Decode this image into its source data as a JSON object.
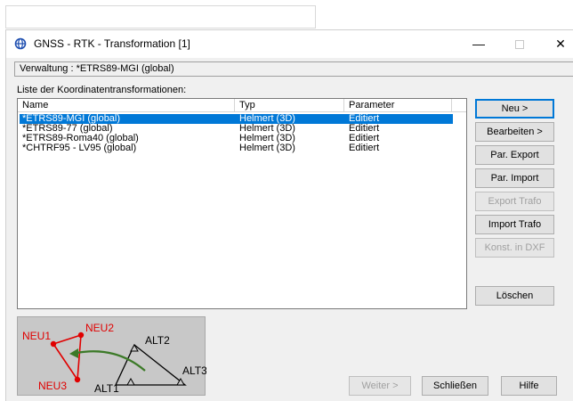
{
  "window": {
    "title": "GNSS - RTK - Transformation [1]",
    "minimize": "—",
    "close": "✕"
  },
  "verwaltung": "Verwaltung : *ETRS89-MGI (global)",
  "list": {
    "label": "Liste der Koordinatentransformationen:",
    "columns": [
      "Name",
      "Typ",
      "Parameter"
    ],
    "rows": [
      {
        "name": "*ETRS89-MGI (global)",
        "typ": "Helmert (3D)",
        "parameter": "Editiert",
        "selected": true
      },
      {
        "name": "*ETRS89-77 (global)",
        "typ": "Helmert (3D)",
        "parameter": "Editiert",
        "selected": false
      },
      {
        "name": "*ETRS89-Roma40 (global)",
        "typ": "Helmert (3D)",
        "parameter": "Editiert",
        "selected": false
      },
      {
        "name": "*CHTRF95 - LV95 (global)",
        "typ": "Helmert (3D)",
        "parameter": "Editiert",
        "selected": false
      }
    ]
  },
  "buttons": {
    "neu": "Neu >",
    "bearbeiten": "Bearbeiten >",
    "par_export": "Par. Export",
    "par_import": "Par. Import",
    "export_trafo": "Export Trafo",
    "import_trafo": "Import Trafo",
    "konst_dxf": "Konst. in DXF",
    "loeschen": "Löschen",
    "weiter": "Weiter >",
    "schliessen": "Schließen",
    "hilfe": "Hilfe"
  },
  "diagram": {
    "neu1": "NEU1",
    "neu2": "NEU2",
    "neu3": "NEU3",
    "alt1": "ALT1",
    "alt2": "ALT2",
    "alt3": "ALT3"
  },
  "colors": {
    "selection": "#0078d7",
    "new_points": "#e00000",
    "arrow": "#3c7a28"
  }
}
